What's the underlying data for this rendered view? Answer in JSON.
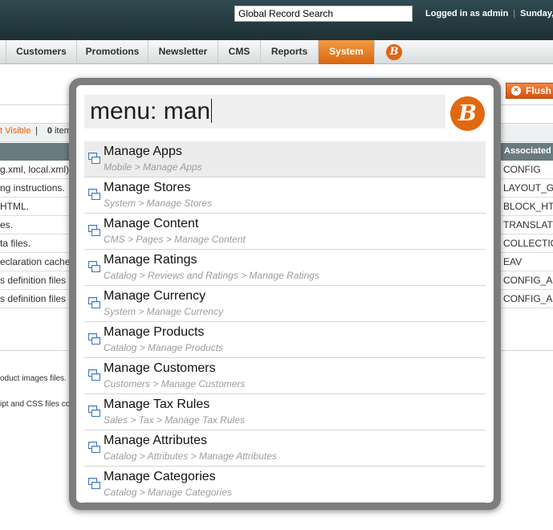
{
  "header": {
    "search_value": "Global Record Search",
    "logged_in": "Logged in as admin",
    "date_fragment": "Sunday, M"
  },
  "nav": {
    "items": [
      "Customers",
      "Promotions",
      "Newsletter",
      "CMS",
      "Reports",
      "System"
    ],
    "active": "System",
    "logo_glyph": "B"
  },
  "page": {
    "flush_label": "Flush",
    "visible_link": "t Visible",
    "items_count": "0",
    "items_label": "items",
    "column_header": "Associated",
    "rows": [
      {
        "left": "g.xml, local.xml) a",
        "right": "CONFIG"
      },
      {
        "left": "ng instructions.",
        "right": "LAYOUT_G"
      },
      {
        "left": "HTML.",
        "right": "BLOCK_HT"
      },
      {
        "left": "es.",
        "right": "TRANSLAT"
      },
      {
        "left": "ta files.",
        "right": "COLLECTIO"
      },
      {
        "left": "eclaration cache.",
        "right": "EAV"
      },
      {
        "left": "s definition files (a",
        "right": "CONFIG_A"
      },
      {
        "left": "s definition files (a",
        "right": "CONFIG_A"
      }
    ],
    "extra_lines": [
      "oduct images files.",
      "ipt and CSS files co"
    ]
  },
  "overlay": {
    "query": "menu: man",
    "logo_glyph": "B",
    "results": [
      {
        "title": "Manage Apps",
        "path": "Mobile > Manage Apps"
      },
      {
        "title": "Manage Stores",
        "path": "System > Manage Stores"
      },
      {
        "title": "Manage Content",
        "path": "CMS > Pages > Manage Content"
      },
      {
        "title": "Manage Ratings",
        "path": "Catalog > Reviews and Ratings > Manage Ratings"
      },
      {
        "title": "Manage Currency",
        "path": "System > Manage Currency"
      },
      {
        "title": "Manage Products",
        "path": "Catalog > Manage Products"
      },
      {
        "title": "Manage Customers",
        "path": "Customers > Manage Customers"
      },
      {
        "title": "Manage Tax Rules",
        "path": "Sales > Tax > Manage Tax Rules"
      },
      {
        "title": "Manage Attributes",
        "path": "Catalog > Attributes > Manage Attributes"
      },
      {
        "title": "Manage Categories",
        "path": "Catalog > Manage Categories"
      }
    ]
  },
  "colors": {
    "accent": "#e2680f",
    "nav_active": "#eb7a1f",
    "header_bg": "#27403f",
    "grid_header": "#6a7b7f"
  },
  "icons": {
    "result_icon": "menu-page-icon",
    "logo": "brand-b-logo-icon"
  }
}
